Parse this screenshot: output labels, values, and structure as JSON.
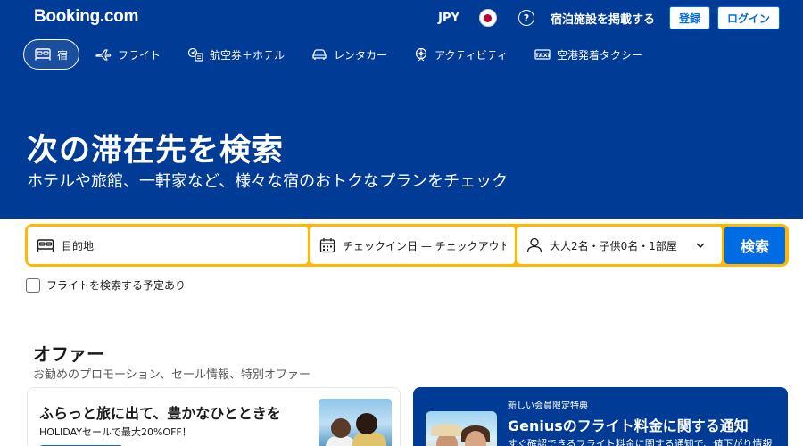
{
  "header": {
    "logo": "Booking.com",
    "currency": "JPY",
    "help_label": "?",
    "list_property": "宿泊施設を掲載する",
    "register": "登録",
    "login": "ログイン"
  },
  "nav": {
    "items": [
      {
        "label": "宿",
        "icon": "bed-icon",
        "active": true
      },
      {
        "label": "フライト",
        "icon": "plane-icon"
      },
      {
        "label": "航空券＋ホテル",
        "icon": "flight-hotel-icon"
      },
      {
        "label": "レンタカー",
        "icon": "car-icon"
      },
      {
        "label": "アクティビティ",
        "icon": "attraction-icon"
      },
      {
        "label": "空港発着タクシー",
        "icon": "taxi-icon"
      }
    ]
  },
  "hero": {
    "title": "次の滞在先を検索",
    "subtitle": "ホテルや旅館、一軒家など、様々な宿のおトクなプランをチェック"
  },
  "search": {
    "destination_placeholder": "目的地",
    "dates_placeholder": "チェックイン日 — チェックアウト日",
    "guests": "大人2名・子供0名・1部屋",
    "button": "検索",
    "flight_checkbox": "フライトを検索する予定あり"
  },
  "offers": {
    "title": "オファー",
    "subtitle": "お勧めのプロモーション、セール情報、特別オファー",
    "card1": {
      "title": "ふらっと旅に出て、豊かなひとときを",
      "subtitle": "HOLIDAYセールで最大20%OFF！"
    },
    "card2": {
      "small": "新しい会員限定特典",
      "title": "Geniusのフライト料金に関する通知",
      "desc": "すぐ確認できるフライト料金に関する通知で、値下がり情報"
    }
  },
  "colors": {
    "brand_blue": "#003b95",
    "accent_blue": "#006ce4",
    "search_yellow": "#ffb700"
  }
}
